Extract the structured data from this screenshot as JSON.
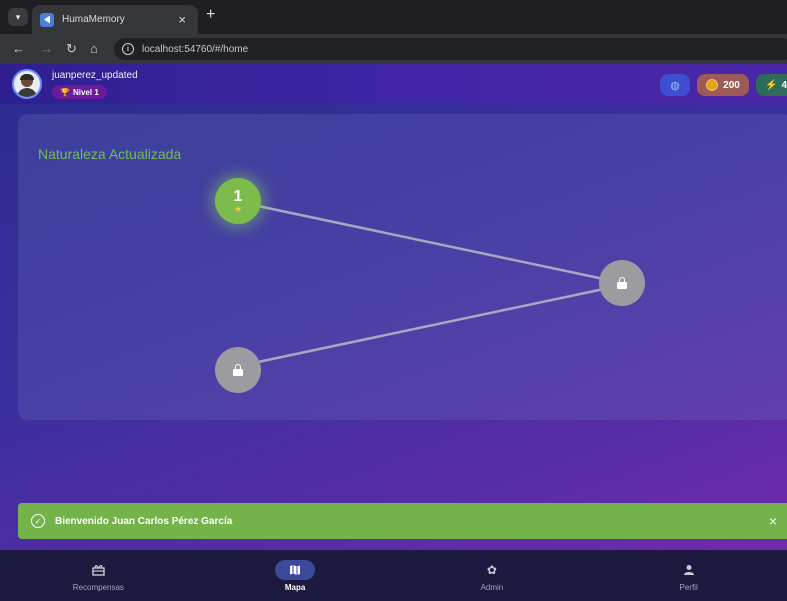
{
  "browser": {
    "tab_title": "HumaMemory",
    "tab_close": "×",
    "new_tab": "+",
    "url": "localhost:54760/#/home",
    "nav_icons": [
      "back-icon",
      "forward-icon",
      "reload-icon",
      "home-icon"
    ]
  },
  "header": {
    "username": "juanperez_updated",
    "level": "Nivel 1",
    "coins": "200",
    "energy": "4"
  },
  "map": {
    "title": "Naturaleza Actualizada",
    "nodes": [
      {
        "number": "1",
        "state": "completed",
        "stars": 1
      },
      {
        "state": "locked"
      },
      {
        "state": "locked"
      }
    ]
  },
  "snackbar": {
    "message": "Bienvenido Juan Carlos Pérez García",
    "close": "×"
  },
  "bottom_nav": {
    "items": [
      {
        "label": "Recompensas",
        "icon": "gift-icon"
      },
      {
        "label": "Mapa",
        "icon": "map-icon",
        "active": true
      },
      {
        "label": "Admin",
        "icon": "gear-icon"
      },
      {
        "label": "Perfil",
        "icon": "person-icon"
      }
    ]
  },
  "colors": {
    "accent_green": "#74b34a",
    "title_green": "#6fbf4f",
    "locked_node": "#9b9ba0",
    "coin_pill": "#9c5a58",
    "nav_bg": "#1c1b3f"
  }
}
